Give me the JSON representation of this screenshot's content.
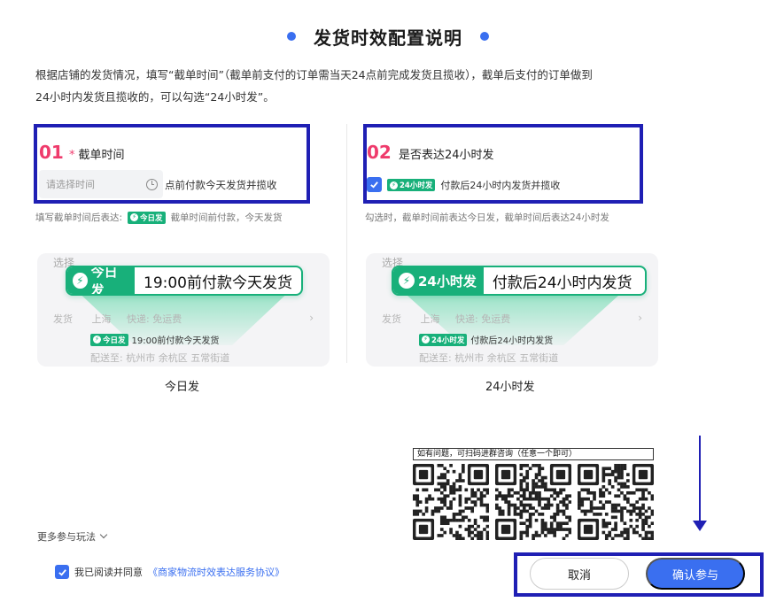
{
  "header": {
    "title": "发货时效配置说明"
  },
  "description": {
    "line1": "根据店铺的发货情况，填写“截单时间”（截单前支付的订单需当天24点前完成发货且揽收），截单后支付的订单做到",
    "line2": "24小时内发货且揽收的，可以勾选“24小时发”。"
  },
  "section1": {
    "number": "01",
    "required_mark": "*",
    "title": "截单时间",
    "time_placeholder": "请选择时间",
    "after_select_text": "点前付款今天发货并揽收",
    "hint_prefix": "填写截单时间后表达:",
    "hint_badge": "今日发",
    "hint_suffix": "截单时间前付款，今天发货"
  },
  "section2": {
    "number": "02",
    "title": "是否表达24小时发",
    "checked": true,
    "option_badge": "24小时发",
    "option_text": "付款后24小时内发货并揽收",
    "hint": "勾选时，截单时间前表达今日发，截单时间后表达24小时发"
  },
  "preview_today": {
    "label_select": "选择",
    "callout_badge": "今日发",
    "callout_text": "19:00前付款今天发货",
    "row_ship": "发货",
    "row_origin": "上海",
    "row_express": "快递: 免运费",
    "mini_badge": "今日发",
    "mini_text": "19:00前付款今天发货",
    "row_dest": "配送至: 杭州市 余杭区 五常街道",
    "caption": "今日发"
  },
  "preview_24h": {
    "label_select": "选择",
    "callout_badge": "24小时发",
    "callout_text": "付款后24小时内发货",
    "row_ship": "发货",
    "row_origin": "上海",
    "row_express": "快递: 免运费",
    "mini_badge": "24小时发",
    "mini_text": "付款后24小时内发货",
    "row_dest": "配送至: 杭州市 余杭区 五常街道",
    "caption": "24小时发"
  },
  "qr": {
    "title": "如有问题，可扫码进群咨询（任意一个即可）"
  },
  "footer": {
    "more_link": "更多参与玩法",
    "agree_text": "我已阅读并同意",
    "agree_link": "《商家物流时效表达服务协议》",
    "cancel_label": "取消",
    "confirm_label": "确认参与"
  },
  "colors": {
    "accent": "#3a6ff0",
    "green": "#18b07a",
    "pink": "#ef3b6c",
    "highlight": "#1f1fb4"
  }
}
